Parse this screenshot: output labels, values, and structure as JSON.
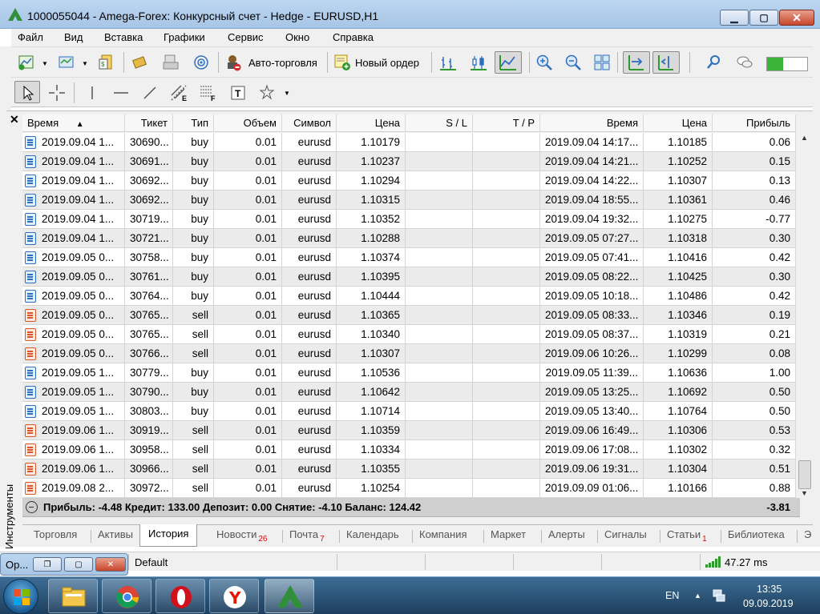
{
  "window": {
    "title": "1000055044 - Amega-Forex: Конкурсный счет - Hedge - EURUSD,H1",
    "min_label": "▁",
    "max_label": "▢",
    "close_label": "✕"
  },
  "menu": [
    "Файл",
    "Вид",
    "Вставка",
    "Графики",
    "Сервис",
    "Окно",
    "Справка"
  ],
  "toolbar": {
    "auto_trading_label": "Авто-торговля",
    "new_order_label": "Новый ордер"
  },
  "panel": {
    "close_label": "✕",
    "side_label": "Инструменты"
  },
  "columns": [
    "Время",
    "Тикет",
    "Тип",
    "Объем",
    "Символ",
    "Цена",
    "S / L",
    "T / P",
    "Время",
    "Цена",
    "Прибыль"
  ],
  "sort_indicator": "▲",
  "rows": [
    {
      "time": "2019.09.04 1...",
      "ticket": "30690...",
      "type": "buy",
      "volume": "0.01",
      "symbol": "eurusd",
      "price": "1.10179",
      "sl": "",
      "tp": "",
      "close_time": "2019.09.04 14:17...",
      "close_price": "1.10185",
      "profit": "0.06"
    },
    {
      "time": "2019.09.04 1...",
      "ticket": "30691...",
      "type": "buy",
      "volume": "0.01",
      "symbol": "eurusd",
      "price": "1.10237",
      "sl": "",
      "tp": "",
      "close_time": "2019.09.04 14:21...",
      "close_price": "1.10252",
      "profit": "0.15"
    },
    {
      "time": "2019.09.04 1...",
      "ticket": "30692...",
      "type": "buy",
      "volume": "0.01",
      "symbol": "eurusd",
      "price": "1.10294",
      "sl": "",
      "tp": "",
      "close_time": "2019.09.04 14:22...",
      "close_price": "1.10307",
      "profit": "0.13"
    },
    {
      "time": "2019.09.04 1...",
      "ticket": "30692...",
      "type": "buy",
      "volume": "0.01",
      "symbol": "eurusd",
      "price": "1.10315",
      "sl": "",
      "tp": "",
      "close_time": "2019.09.04 18:55...",
      "close_price": "1.10361",
      "profit": "0.46"
    },
    {
      "time": "2019.09.04 1...",
      "ticket": "30719...",
      "type": "buy",
      "volume": "0.01",
      "symbol": "eurusd",
      "price": "1.10352",
      "sl": "",
      "tp": "",
      "close_time": "2019.09.04 19:32...",
      "close_price": "1.10275",
      "profit": "-0.77"
    },
    {
      "time": "2019.09.04 1...",
      "ticket": "30721...",
      "type": "buy",
      "volume": "0.01",
      "symbol": "eurusd",
      "price": "1.10288",
      "sl": "",
      "tp": "",
      "close_time": "2019.09.05 07:27...",
      "close_price": "1.10318",
      "profit": "0.30"
    },
    {
      "time": "2019.09.05 0...",
      "ticket": "30758...",
      "type": "buy",
      "volume": "0.01",
      "symbol": "eurusd",
      "price": "1.10374",
      "sl": "",
      "tp": "",
      "close_time": "2019.09.05 07:41...",
      "close_price": "1.10416",
      "profit": "0.42"
    },
    {
      "time": "2019.09.05 0...",
      "ticket": "30761...",
      "type": "buy",
      "volume": "0.01",
      "symbol": "eurusd",
      "price": "1.10395",
      "sl": "",
      "tp": "",
      "close_time": "2019.09.05 08:22...",
      "close_price": "1.10425",
      "profit": "0.30"
    },
    {
      "time": "2019.09.05 0...",
      "ticket": "30764...",
      "type": "buy",
      "volume": "0.01",
      "symbol": "eurusd",
      "price": "1.10444",
      "sl": "",
      "tp": "",
      "close_time": "2019.09.05 10:18...",
      "close_price": "1.10486",
      "profit": "0.42"
    },
    {
      "time": "2019.09.05 0...",
      "ticket": "30765...",
      "type": "sell",
      "volume": "0.01",
      "symbol": "eurusd",
      "price": "1.10365",
      "sl": "",
      "tp": "",
      "close_time": "2019.09.05 08:33...",
      "close_price": "1.10346",
      "profit": "0.19"
    },
    {
      "time": "2019.09.05 0...",
      "ticket": "30765...",
      "type": "sell",
      "volume": "0.01",
      "symbol": "eurusd",
      "price": "1.10340",
      "sl": "",
      "tp": "",
      "close_time": "2019.09.05 08:37...",
      "close_price": "1.10319",
      "profit": "0.21"
    },
    {
      "time": "2019.09.05 0...",
      "ticket": "30766...",
      "type": "sell",
      "volume": "0.01",
      "symbol": "eurusd",
      "price": "1.10307",
      "sl": "",
      "tp": "",
      "close_time": "2019.09.06 10:26...",
      "close_price": "1.10299",
      "profit": "0.08"
    },
    {
      "time": "2019.09.05 1...",
      "ticket": "30779...",
      "type": "buy",
      "volume": "0.01",
      "symbol": "eurusd",
      "price": "1.10536",
      "sl": "",
      "tp": "",
      "close_time": "2019.09.05 11:39...",
      "close_price": "1.10636",
      "profit": "1.00"
    },
    {
      "time": "2019.09.05 1...",
      "ticket": "30790...",
      "type": "buy",
      "volume": "0.01",
      "symbol": "eurusd",
      "price": "1.10642",
      "sl": "",
      "tp": "",
      "close_time": "2019.09.05 13:25...",
      "close_price": "1.10692",
      "profit": "0.50"
    },
    {
      "time": "2019.09.05 1...",
      "ticket": "30803...",
      "type": "buy",
      "volume": "0.01",
      "symbol": "eurusd",
      "price": "1.10714",
      "sl": "",
      "tp": "",
      "close_time": "2019.09.05 13:40...",
      "close_price": "1.10764",
      "profit": "0.50"
    },
    {
      "time": "2019.09.06 1...",
      "ticket": "30919...",
      "type": "sell",
      "volume": "0.01",
      "symbol": "eurusd",
      "price": "1.10359",
      "sl": "",
      "tp": "",
      "close_time": "2019.09.06 16:49...",
      "close_price": "1.10306",
      "profit": "0.53"
    },
    {
      "time": "2019.09.06 1...",
      "ticket": "30958...",
      "type": "sell",
      "volume": "0.01",
      "symbol": "eurusd",
      "price": "1.10334",
      "sl": "",
      "tp": "",
      "close_time": "2019.09.06 17:08...",
      "close_price": "1.10302",
      "profit": "0.32"
    },
    {
      "time": "2019.09.06 1...",
      "ticket": "30966...",
      "type": "sell",
      "volume": "0.01",
      "symbol": "eurusd",
      "price": "1.10355",
      "sl": "",
      "tp": "",
      "close_time": "2019.09.06 19:31...",
      "close_price": "1.10304",
      "profit": "0.51"
    },
    {
      "time": "2019.09.08 2...",
      "ticket": "30972...",
      "type": "sell",
      "volume": "0.01",
      "symbol": "eurusd",
      "price": "1.10254",
      "sl": "",
      "tp": "",
      "close_time": "2019.09.09 01:06...",
      "close_price": "1.10166",
      "profit": "0.88"
    }
  ],
  "summary": {
    "text": "Прибыль: -4.48  Кредит: 133.00  Депозит: 0.00  Снятие: -4.10  Баланс: 124.42",
    "total": "-3.81"
  },
  "tabs": [
    {
      "label": "Торговля",
      "badge": ""
    },
    {
      "label": "Активы",
      "badge": ""
    },
    {
      "label": "История",
      "badge": ""
    },
    {
      "label": "Новости",
      "badge": "26"
    },
    {
      "label": "Почта",
      "badge": "7"
    },
    {
      "label": "Календарь",
      "badge": ""
    },
    {
      "label": "Компания",
      "badge": ""
    },
    {
      "label": "Маркет",
      "badge": ""
    },
    {
      "label": "Алерты",
      "badge": ""
    },
    {
      "label": "Сигналы",
      "badge": ""
    },
    {
      "label": "Статьи",
      "badge": "1"
    },
    {
      "label": "Библиотека",
      "badge": ""
    },
    {
      "label": "Э",
      "badge": ""
    }
  ],
  "active_tab": "История",
  "status": {
    "profile": "Default",
    "ping": "47.27 ms"
  },
  "mini_window": {
    "title": "Op..."
  },
  "taskbar": {
    "lang": "EN",
    "time": "13:35",
    "date": "09.09.2019"
  },
  "colors": {
    "buy_icon": "#2d6fbf",
    "sell_icon": "#d8572a",
    "title_bar": "#bcd6f0",
    "taskbar": "#1d3f5e"
  }
}
